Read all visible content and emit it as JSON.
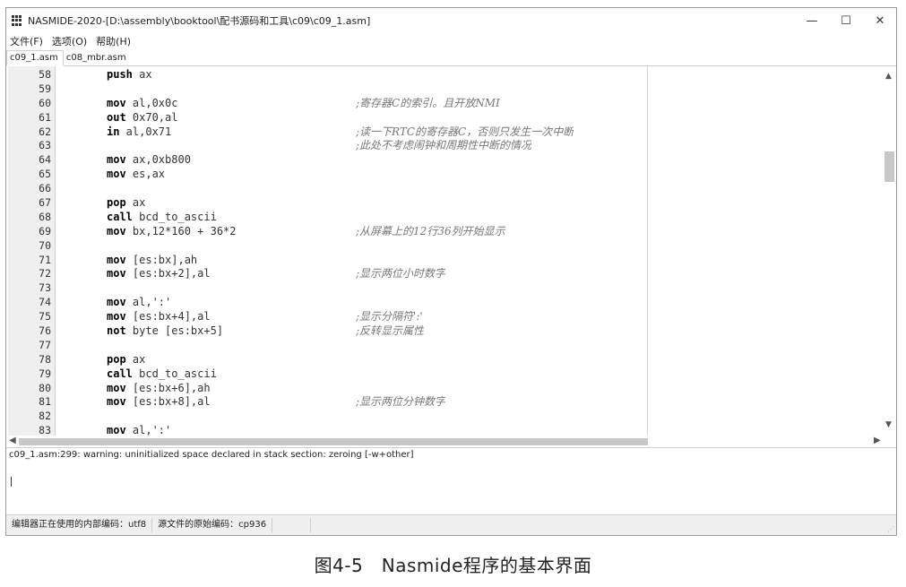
{
  "window": {
    "title": "NASMIDE-2020-[D:\\assembly\\booktool\\配书源码和工具\\c09\\c09_1.asm]",
    "controls": {
      "minimize": "—",
      "maximize": "☐",
      "close": "✕"
    }
  },
  "menu": [
    "文件(F)",
    "选项(O)",
    "帮助(H)"
  ],
  "tabs": [
    {
      "label": "c09_1.asm",
      "active": true
    },
    {
      "label": "c08_mbr.asm",
      "active": false
    }
  ],
  "editor": {
    "lines": [
      {
        "n": "58",
        "kw": "push",
        "rest": " ax",
        "comment": ""
      },
      {
        "n": "59",
        "kw": "",
        "rest": "",
        "comment": ""
      },
      {
        "n": "60",
        "kw": "mov",
        "rest": " al,0x0c",
        "comment": ";寄存器C的索引。且开放NMI"
      },
      {
        "n": "61",
        "kw": "out",
        "rest": " 0x70,al",
        "comment": ""
      },
      {
        "n": "62",
        "kw": "in",
        "rest": " al,0x71",
        "comment": ";读一下RTC的寄存器C，否则只发生一次中断"
      },
      {
        "n": "63",
        "kw": "",
        "rest": "",
        "comment": ";此处不考虑闹钟和周期性中断的情况"
      },
      {
        "n": "64",
        "kw": "mov",
        "rest": " ax,0xb800",
        "comment": ""
      },
      {
        "n": "65",
        "kw": "mov",
        "rest": " es,ax",
        "comment": ""
      },
      {
        "n": "66",
        "kw": "",
        "rest": "",
        "comment": ""
      },
      {
        "n": "67",
        "kw": "pop",
        "rest": " ax",
        "comment": ""
      },
      {
        "n": "68",
        "kw": "call",
        "rest": " bcd_to_ascii",
        "comment": ""
      },
      {
        "n": "69",
        "kw": "mov",
        "rest": " bx,12*160 + 36*2",
        "comment": ";从屏幕上的12行36列开始显示"
      },
      {
        "n": "70",
        "kw": "",
        "rest": "",
        "comment": ""
      },
      {
        "n": "71",
        "kw": "mov",
        "rest": " [es:bx],ah",
        "comment": ""
      },
      {
        "n": "72",
        "kw": "mov",
        "rest": " [es:bx+2],al",
        "comment": ";显示两位小时数字"
      },
      {
        "n": "73",
        "kw": "",
        "rest": "",
        "comment": ""
      },
      {
        "n": "74",
        "kw": "mov",
        "rest": " al,':'",
        "comment": ""
      },
      {
        "n": "75",
        "kw": "mov",
        "rest": " [es:bx+4],al",
        "comment": ";显示分隔符':'"
      },
      {
        "n": "76",
        "kw": "not",
        "rest": " byte [es:bx+5]",
        "comment": ";反转显示属性"
      },
      {
        "n": "77",
        "kw": "",
        "rest": "",
        "comment": ""
      },
      {
        "n": "78",
        "kw": "pop",
        "rest": " ax",
        "comment": ""
      },
      {
        "n": "79",
        "kw": "call",
        "rest": " bcd_to_ascii",
        "comment": ""
      },
      {
        "n": "80",
        "kw": "mov",
        "rest": " [es:bx+6],ah",
        "comment": ""
      },
      {
        "n": "81",
        "kw": "mov",
        "rest": " [es:bx+8],al",
        "comment": ";显示两位分钟数字"
      },
      {
        "n": "82",
        "kw": "",
        "rest": "",
        "comment": ""
      },
      {
        "n": "83",
        "kw": "mov",
        "rest": " al,':'",
        "comment": ""
      }
    ]
  },
  "output": {
    "message": "c09_1.asm:299: warning: uninitialized space declared in stack section: zeroing [-w+other]"
  },
  "status": {
    "internal_encoding": "编辑器正在使用的内部编码：utf8",
    "source_encoding": "源文件的原始编码：cp936"
  },
  "caption": "图4-5　Nasmide程序的基本界面"
}
